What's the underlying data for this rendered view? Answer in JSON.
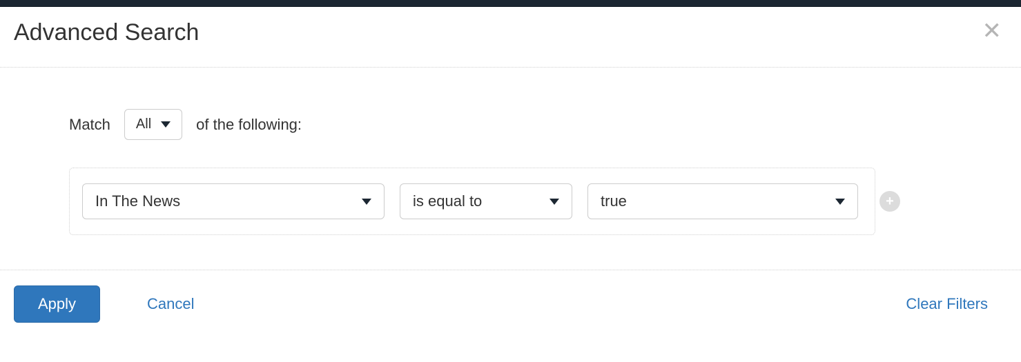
{
  "header": {
    "title": "Advanced Search"
  },
  "match": {
    "prefix": "Match",
    "mode": "All",
    "suffix": "of the following:"
  },
  "filter": {
    "field": "In The News",
    "operator": "is equal to",
    "value": "true"
  },
  "footer": {
    "apply": "Apply",
    "cancel": "Cancel",
    "clear": "Clear Filters"
  }
}
